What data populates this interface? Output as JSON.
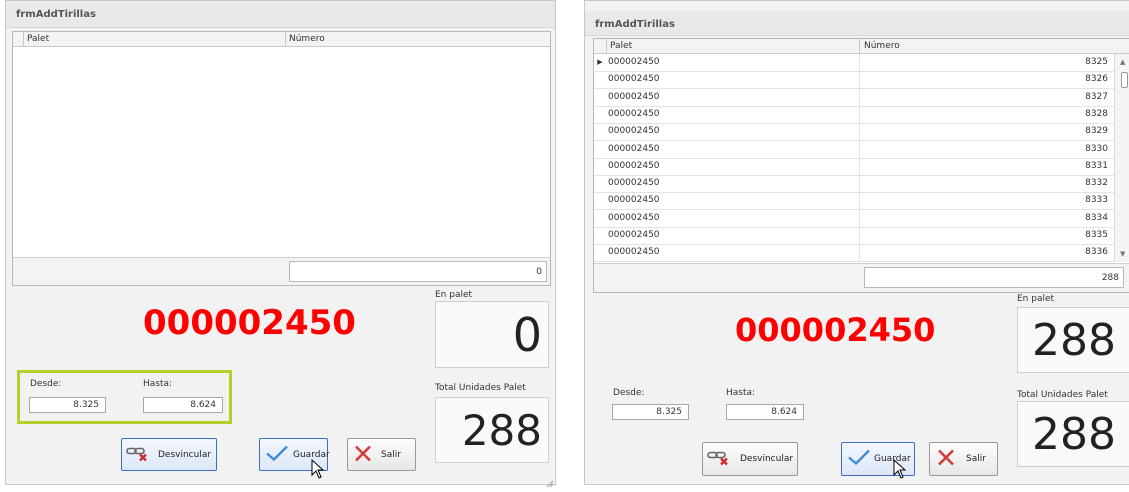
{
  "left": {
    "title": "frmAddTirillas",
    "grid": {
      "col_palet": "Palet",
      "col_numero": "Número",
      "footer_total": "0"
    },
    "pallet_code": "000002450",
    "desde_label": "Desde:",
    "desde_value": "8.325",
    "hasta_label": "Hasta:",
    "hasta_value": "8.624",
    "en_palet_label": "En palet",
    "en_palet_value": "0",
    "total_label": "Total Unidades Palet",
    "total_value": "288",
    "btn_desvincular": "Desvincular",
    "btn_guardar": "Guardar",
    "btn_salir": "Salir"
  },
  "right": {
    "title": "frmAddTirillas",
    "grid": {
      "col_palet": "Palet",
      "col_numero": "Número",
      "rows": [
        {
          "palet": "000002450",
          "numero": "8325"
        },
        {
          "palet": "000002450",
          "numero": "8326"
        },
        {
          "palet": "000002450",
          "numero": "8327"
        },
        {
          "palet": "000002450",
          "numero": "8328"
        },
        {
          "palet": "000002450",
          "numero": "8329"
        },
        {
          "palet": "000002450",
          "numero": "8330"
        },
        {
          "palet": "000002450",
          "numero": "8331"
        },
        {
          "palet": "000002450",
          "numero": "8332"
        },
        {
          "palet": "000002450",
          "numero": "8333"
        },
        {
          "palet": "000002450",
          "numero": "8334"
        },
        {
          "palet": "000002450",
          "numero": "8335"
        },
        {
          "palet": "000002450",
          "numero": "8336"
        }
      ],
      "footer_total": "288"
    },
    "pallet_code": "000002450",
    "desde_label": "Desde:",
    "desde_value": "8.325",
    "hasta_label": "Hasta:",
    "hasta_value": "8.624",
    "en_palet_label": "En palet",
    "en_palet_value": "288",
    "total_label": "Total Unidades Palet",
    "total_value": "288",
    "btn_desvincular": "Desvincular",
    "btn_guardar": "Guardar",
    "btn_salir": "Salir"
  },
  "colors": {
    "accent_red": "#ff0000",
    "highlight": "#b5cf2b",
    "focus_blue": "#3a6fc4"
  }
}
